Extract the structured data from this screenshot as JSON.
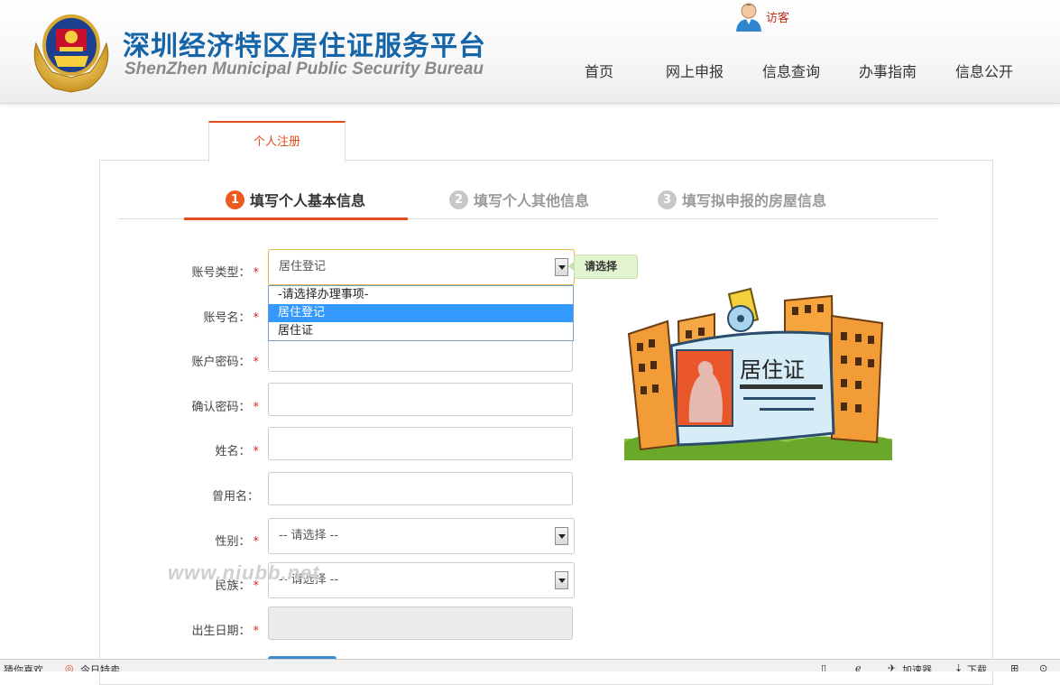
{
  "header": {
    "title": "深圳经济特区居住证服务平台",
    "subtitle": "ShenZhen Municipal Public Security Bureau",
    "user": "访客",
    "nav": [
      "首页",
      "网上申报",
      "信息查询",
      "办事指南",
      "信息公开"
    ]
  },
  "tab": {
    "label": "个人注册"
  },
  "steps": [
    {
      "num": "1",
      "label": "填写个人基本信息",
      "active": true
    },
    {
      "num": "2",
      "label": "填写个人其他信息",
      "active": false
    },
    {
      "num": "3",
      "label": "填写拟申报的房屋信息",
      "active": false
    }
  ],
  "form": {
    "account_type": {
      "label": "账号类型：",
      "value": "居住登记",
      "hint": "请选择",
      "options": [
        "-请选择办理事项-",
        "居住登记",
        "居住证"
      ],
      "highlighted": "居住登记"
    },
    "account_name": {
      "label": "账号名："
    },
    "password": {
      "label": "账户密码："
    },
    "confirm_password": {
      "label": "确认密码："
    },
    "name": {
      "label": "姓名："
    },
    "former_name": {
      "label": "曾用名："
    },
    "gender": {
      "label": "性别：",
      "value": "-- 请选择 --"
    },
    "ethnicity": {
      "label": "民族：",
      "value": "-- 请选择 --"
    },
    "birth_date": {
      "label": "出生日期："
    },
    "required_mark": "*"
  },
  "illustration": {
    "card_text": "居住证"
  },
  "watermark": "www.niubb.net",
  "statusbar": {
    "left": [
      "猜你喜欢",
      "今日特卖"
    ],
    "right": [
      "加速器",
      "下载"
    ]
  },
  "colors": {
    "title_blue": "#1565a8",
    "accent_orange": "#e04e1b",
    "required_red": "#e02424",
    "option_highlight": "#3399ff",
    "hint_green": "#e2f3cf"
  }
}
